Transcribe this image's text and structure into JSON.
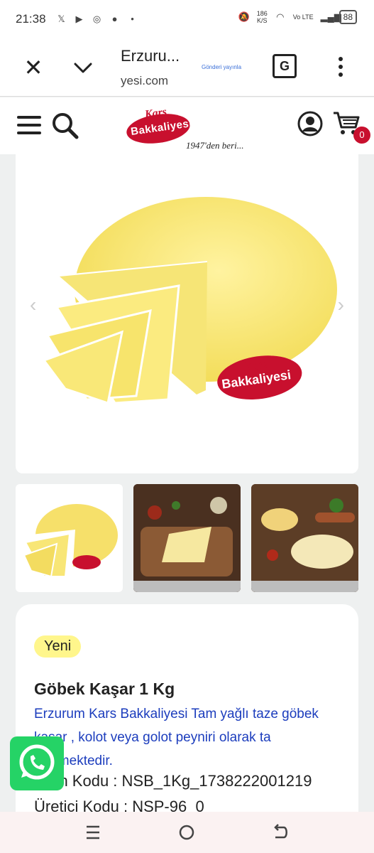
{
  "status_bar": {
    "time": "21:38",
    "speed_value": "186",
    "speed_unit": "K/S",
    "network": "Vo LTE",
    "battery": "88"
  },
  "browser": {
    "title": "Erzuru...",
    "url_visible": "yesi.com",
    "send_label": "Gönderi yayınla"
  },
  "site": {
    "logo_line1": "Kars",
    "logo_line2": "Bakkaliyesi",
    "logo_tagline": "1947'den beri...",
    "cart_count": "0"
  },
  "product": {
    "badge": "Yeni",
    "title": "Göbek Kaşar 1 Kg",
    "description": "Erzurum Kars Bakkaliyesi Tam yağlı taze göbek kaşar , kolot veya golot peyniri olarak ta bilinmektedir.",
    "product_code_label": "Ürün Kodu :",
    "product_code": "NSB_1Kg_1738222001219",
    "producer_code_label": "Üretici Kodu :",
    "producer_code": "NSP-96_0"
  },
  "colors": {
    "brand_red": "#c8102e",
    "link_blue": "#1c3dbd",
    "badge_yellow": "#fff68c",
    "whatsapp_green": "#25d366"
  }
}
